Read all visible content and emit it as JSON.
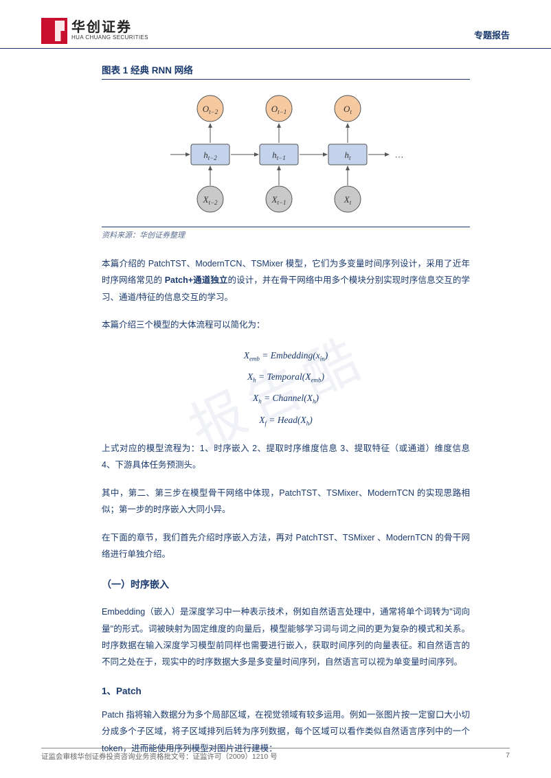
{
  "header": {
    "logo_cn": "华创证券",
    "logo_en": "HUA CHUANG SECURITIES",
    "right_label": "专题报告"
  },
  "watermark": "报告酷",
  "figure": {
    "title": "图表 1  经典 RNN 网络",
    "nodes": {
      "o2": "O",
      "o2_sub": "t−2",
      "o1": "O",
      "o1_sub": "t−1",
      "o0": "O",
      "o0_sub": "t",
      "h2": "h",
      "h2_sub": "t−2",
      "h1": "h",
      "h1_sub": "t−1",
      "h0": "h",
      "h0_sub": "t",
      "x2": "X",
      "x2_sub": "t−2",
      "x1": "X",
      "x1_sub": "t−1",
      "x0": "X",
      "x0_sub": "t",
      "dots": "…"
    },
    "source": "资料来源：华创证券整理"
  },
  "body": {
    "p1a": "本篇介绍的 PatchTST、ModernTCN、TSMixer 模型，它们为多变量时间序列设计，采用了近年时序网络常见的 ",
    "p1b": "Patch+通道独立",
    "p1c": "的设计，并在骨干网络中用多个模块分别实现时序信息交互的学习、通道/特征的信息交互的学习。",
    "p2": "本篇介绍三个模型的大体流程可以简化为：",
    "p3": "上式对应的模型流程为：1、时序嵌入 2、提取时序维度信息 3、提取特征（或通道）维度信息 4、下游具体任务预测头。",
    "p4": "其中，第二、第三步在模型骨干网络中体现，PatchTST、TSMixer、ModernTCN 的实现思路相似；第一步的时序嵌入大同小异。",
    "p5": "在下面的章节，我们首先介绍时序嵌入方法，再对 PatchTST、TSMixer 、ModernTCN 的骨干网络进行单独介绍。",
    "sec1_title": "（一）时序嵌入",
    "sec1_p1": "Embedding（嵌入）是深度学习中一种表示技术，例如自然语言处理中，通常将单个词转为\"词向量\"的形式。词被映射为固定维度的向量后，模型能够学习词与词之间的更为复杂的模式和关系。时序数据在输入深度学习模型前同样也需要进行嵌入，获取时间序列的向量表征。和自然语言的不同之处在于，现实中的时序数据大多是多变量时间序列，自然语言可以视为单变量时间序列。",
    "sub1_title": "1、Patch",
    "sub1_p1": "Patch 指将输入数据分为多个局部区域，在视觉领域有较多运用。例如一张图片按一定窗口大小切分成多个子区域，将子区域排列后转为序列数据，每个区域可以看作类似自然语言序列中的一个 token，进而能使用序列模型对图片进行建模："
  },
  "formulas": {
    "f1_lhs": "X",
    "f1_sub": "emb",
    "f1_eq": " = Embedding(x",
    "f1_rsub": "in",
    "f1_end": ")",
    "f2_lhs": "X",
    "f2_sub": "h",
    "f2_eq": " = Temporal(X",
    "f2_rsub": "emb",
    "f2_end": ")",
    "f3_lhs": "X",
    "f3_sub": "h",
    "f3_eq": " = Channel(X",
    "f3_rsub": "h",
    "f3_end": ")",
    "f4_lhs": "X",
    "f4_sub": "f",
    "f4_eq": " = Head(X",
    "f4_rsub": "h",
    "f4_end": ")"
  },
  "footer": {
    "left": "证监会审核华创证券投资咨询业务资格批文号：证监许可（2009）1210 号",
    "right": "7"
  }
}
